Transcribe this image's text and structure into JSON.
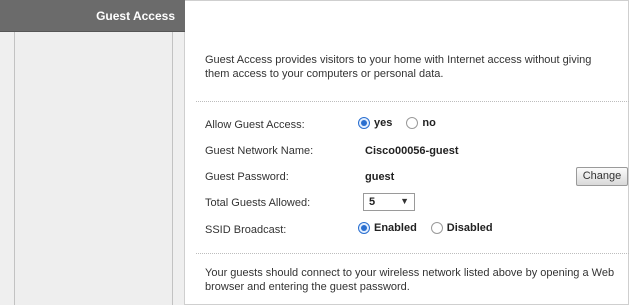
{
  "sidebar": {
    "title": "Guest Access"
  },
  "main": {
    "intro": "Guest Access provides visitors to your home with Internet access without giving them access to your computers or personal data.",
    "fields": {
      "allow_guest_access": {
        "label": "Allow Guest Access:",
        "options": [
          "yes",
          "no"
        ],
        "selected": "yes"
      },
      "network_name": {
        "label": "Guest Network Name:",
        "value": "Cisco00056-guest"
      },
      "password": {
        "label": "Guest Password:",
        "value": "guest",
        "button_label": "Change"
      },
      "total_guests": {
        "label": "Total Guests Allowed:",
        "value": "5"
      },
      "ssid_broadcast": {
        "label": "SSID Broadcast:",
        "options": [
          "Enabled",
          "Disabled"
        ],
        "selected": "Enabled"
      }
    },
    "footer": "Your guests should connect to your wireless network listed above by opening a Web browser and entering the guest password."
  },
  "colors": {
    "sidebar_header": "#6b6b6b",
    "sidebar_bg": "#efefef",
    "radio_accent": "#2a6fd0"
  }
}
